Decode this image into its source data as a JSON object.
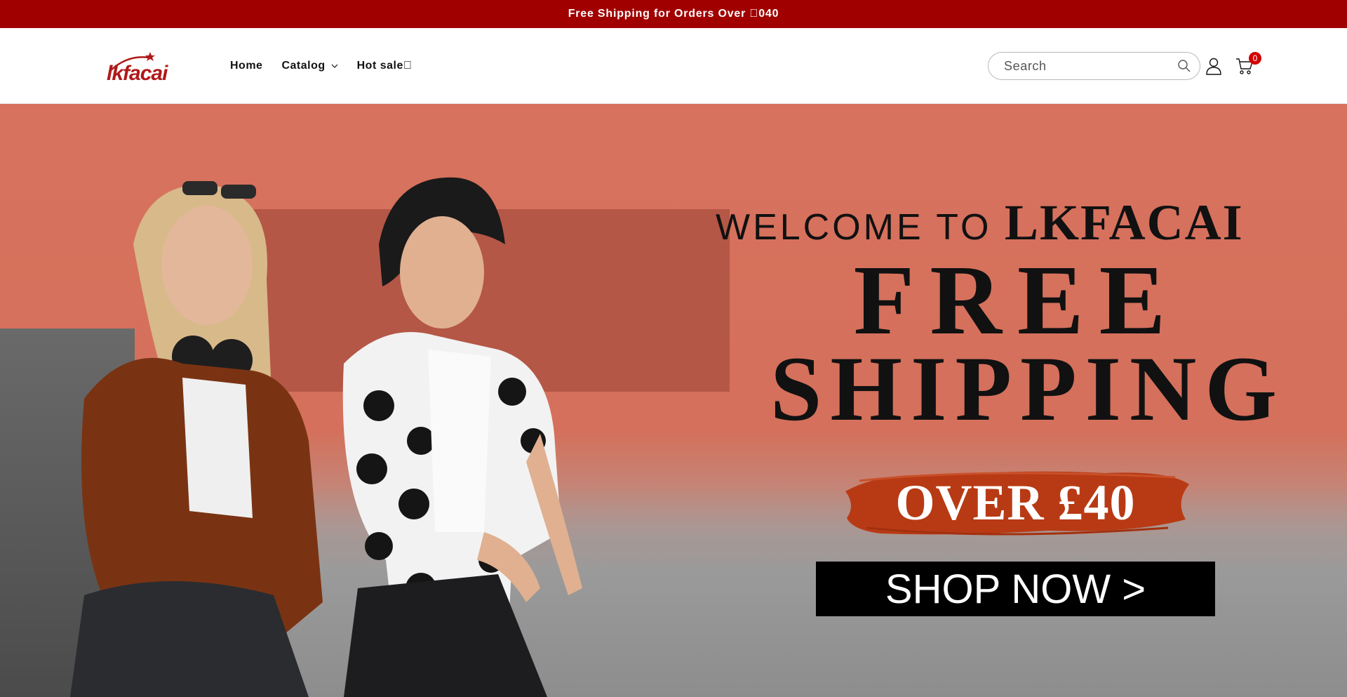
{
  "announcement": {
    "text": "Free Shipping for Orders Over \u0000040"
  },
  "header": {
    "logo_text": "lkfacai",
    "nav": [
      {
        "label": "Home"
      },
      {
        "label": "Catalog"
      },
      {
        "label": "Hot sale"
      }
    ],
    "search": {
      "placeholder": "Search",
      "value": ""
    },
    "cart_count": "0",
    "icons": [
      "search-icon",
      "account-icon",
      "cart-icon",
      "chevron-down-icon"
    ]
  },
  "hero": {
    "welcome_prefix": "WELCOME TO",
    "welcome_brand": "LKFACAI",
    "line1": "FREE",
    "line2": "SHIPPING",
    "offer": "OVER £40",
    "cta": "SHOP NOW >"
  },
  "colors": {
    "announcement_bg": "#a10000",
    "hero_bg": "#d4705b",
    "brush": "#b83a14",
    "cta_bg": "#000000"
  }
}
